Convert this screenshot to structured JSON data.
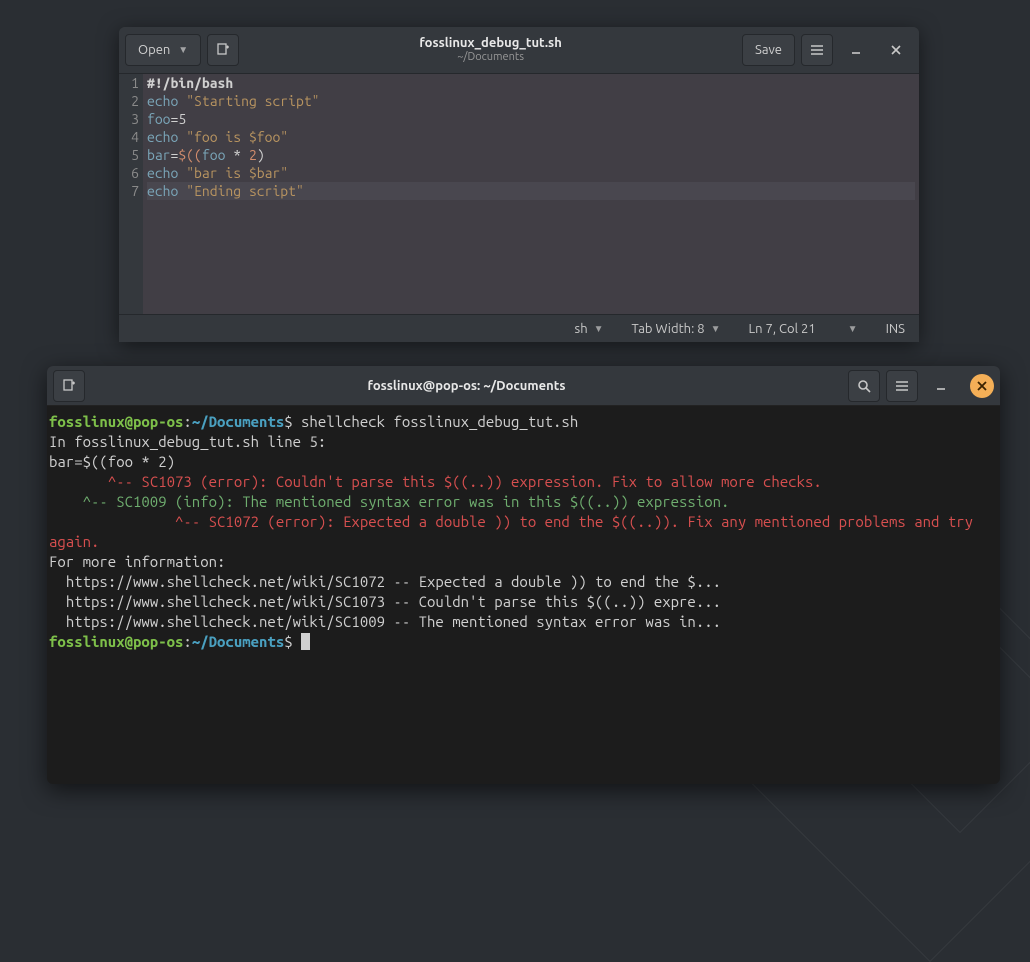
{
  "editor": {
    "open_label": "Open",
    "save_label": "Save",
    "filename": "fosslinux_debug_tut.sh",
    "path": "~/Documents",
    "status": {
      "lang": "sh",
      "tabwidth_label": "Tab Width: 8",
      "position": "Ln 7, Col 21",
      "mode": "INS"
    },
    "lines": [
      {
        "n": "1",
        "tokens": [
          {
            "c": "tok-she",
            "t": "#!/bin/bash"
          }
        ]
      },
      {
        "n": "2",
        "tokens": [
          {
            "c": "tok-kw",
            "t": "echo"
          },
          {
            "c": "tok-op",
            "t": " "
          },
          {
            "c": "tok-str",
            "t": "\"Starting script\""
          }
        ]
      },
      {
        "n": "3",
        "tokens": [
          {
            "c": "tok-var",
            "t": "foo"
          },
          {
            "c": "tok-op",
            "t": "=5"
          }
        ]
      },
      {
        "n": "4",
        "tokens": [
          {
            "c": "tok-kw",
            "t": "echo"
          },
          {
            "c": "tok-op",
            "t": " "
          },
          {
            "c": "tok-str",
            "t": "\"foo is $foo\""
          }
        ]
      },
      {
        "n": "5",
        "tokens": [
          {
            "c": "tok-var",
            "t": "bar"
          },
          {
            "c": "tok-op",
            "t": "="
          },
          {
            "c": "tok-num",
            "t": "$(("
          },
          {
            "c": "tok-var",
            "t": "foo"
          },
          {
            "c": "tok-op",
            "t": " * "
          },
          {
            "c": "tok-num",
            "t": "2"
          },
          {
            "c": "tok-op",
            "t": ")"
          }
        ]
      },
      {
        "n": "6",
        "tokens": [
          {
            "c": "tok-kw",
            "t": "echo"
          },
          {
            "c": "tok-op",
            "t": " "
          },
          {
            "c": "tok-str",
            "t": "\"bar is $bar\""
          }
        ]
      },
      {
        "n": "7",
        "hl": true,
        "tokens": [
          {
            "c": "tok-kw",
            "t": "echo"
          },
          {
            "c": "tok-op",
            "t": " "
          },
          {
            "c": "tok-str",
            "t": "\"Ending script\""
          }
        ]
      }
    ]
  },
  "terminal": {
    "title": "fosslinux@pop-os: ~/Documents",
    "prompt": {
      "user": "fosslinux@pop-os",
      "sep": ":",
      "path": "~/Documents",
      "symbol": "$"
    },
    "command": " shellcheck fosslinux_debug_tut.sh",
    "output": [
      {
        "c": "t-plain",
        "t": ""
      },
      {
        "c": "t-plain",
        "t": "In fosslinux_debug_tut.sh line 5:"
      },
      {
        "c": "t-plain",
        "t": "bar=$((foo * 2)"
      },
      {
        "c": "t-err",
        "t": "       ^-- SC1073 (error): Couldn't parse this $((..)) expression. Fix to allow more checks."
      },
      {
        "c": "t-info",
        "t": "    ^-- SC1009 (info): The mentioned syntax error was in this $((..)) expression."
      },
      {
        "c": "t-err",
        "t": "               ^-- SC1072 (error): Expected a double )) to end the $((..)). Fix any mentioned problems and try again."
      },
      {
        "c": "t-plain",
        "t": ""
      },
      {
        "c": "t-plain",
        "t": "For more information:"
      },
      {
        "c": "t-plain",
        "t": "  https://www.shellcheck.net/wiki/SC1072 -- Expected a double )) to end the $..."
      },
      {
        "c": "t-plain",
        "t": "  https://www.shellcheck.net/wiki/SC1073 -- Couldn't parse this $((..)) expre..."
      },
      {
        "c": "t-plain",
        "t": "  https://www.shellcheck.net/wiki/SC1009 -- The mentioned syntax error was in..."
      }
    ]
  }
}
